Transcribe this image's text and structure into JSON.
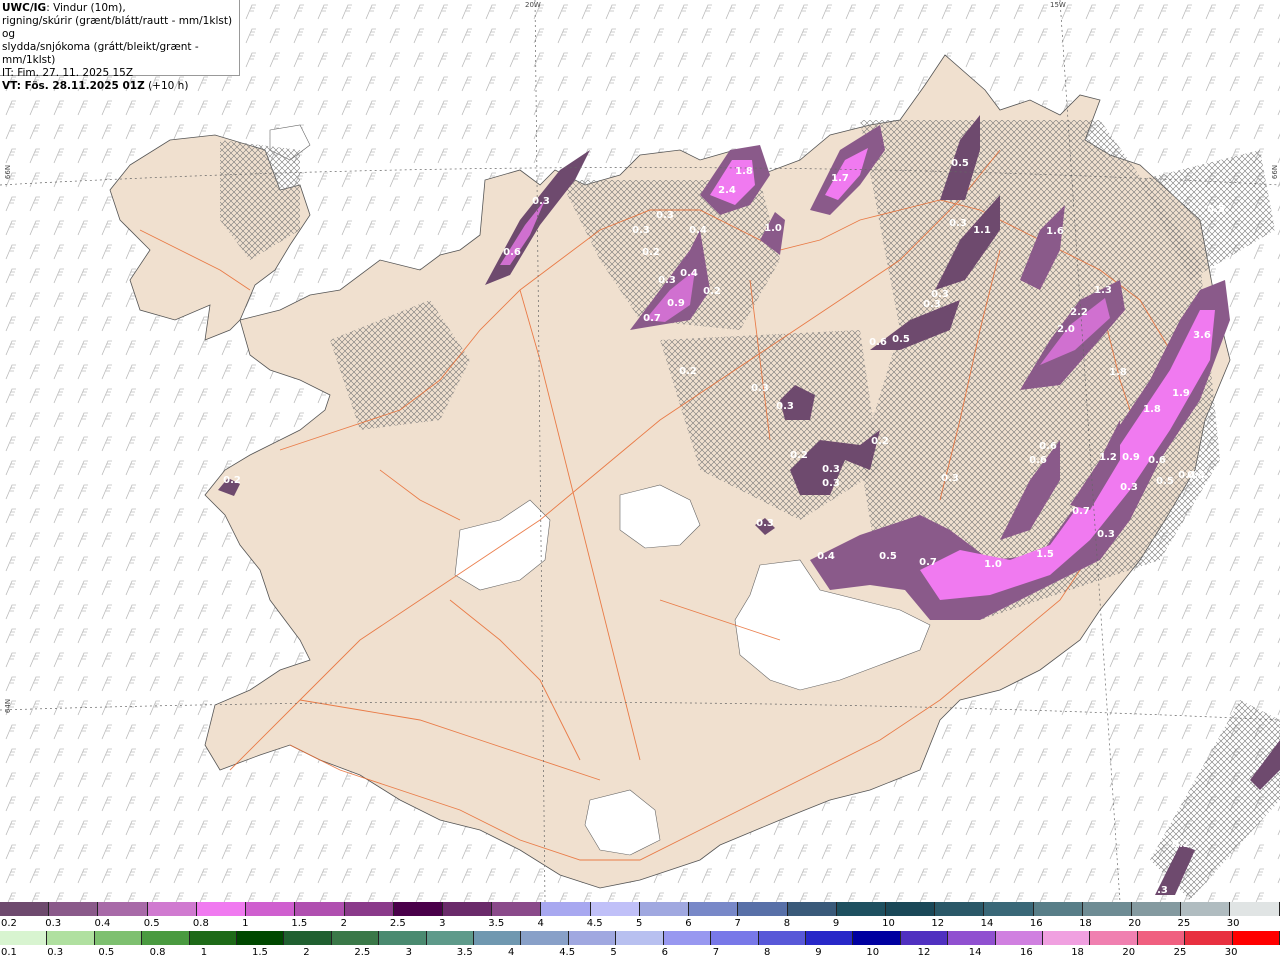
{
  "info": {
    "model": "UWC/IG",
    "line1_rest": ": Vindur (10m),",
    "line2": "rigning/skúrir (grænt/blátt/rautt - mm/1klst) og",
    "line3": "slydda/snjókoma (grátt/bleikt/grænt - mm/1klst)",
    "it": "IT: Fim. 27. 11. 2025 15Z",
    "vt_bold": "VT: Fös. 28.11.2025 01Z",
    "vt_rest": " (+10 h)"
  },
  "grid_labels": {
    "lon_20w": "20W",
    "lon_15w": "15W",
    "lat_66n_left": "66N",
    "lat_66n_right": "66N",
    "lat_64n_left": "64N"
  },
  "precip_labels": [
    "0.3",
    "0.6",
    "0.2",
    "1.8",
    "2.4",
    "1.7",
    "0.3",
    "0.3",
    "0.4",
    "0.2",
    "0.4",
    "0.3",
    "0.9",
    "0.7",
    "0.2",
    "1.0",
    "0.5",
    "0.3",
    "1.1",
    "1.6",
    "0.5",
    "0.3",
    "0.3",
    "1.3",
    "2.2",
    "2.0",
    "3.6",
    "0.6",
    "0.5",
    "0.2",
    "0.3",
    "0.3",
    "1.8",
    "1.8",
    "1.9",
    "0.2",
    "0.3",
    "0.3",
    "0.2",
    "0.3",
    "0.6",
    "0.6",
    "1.2",
    "0.9",
    "0.6",
    "0.4",
    "0.5",
    "0.3",
    "0.7",
    "0.4",
    "0.5",
    "0.7",
    "1.0",
    "1.5",
    "0.3",
    "0.3",
    "0.2",
    "0.4",
    "0.2",
    "0.3"
  ],
  "legend_snow": {
    "labels": [
      "0.2",
      "0.3",
      "0.4",
      "0.5",
      "0.8",
      "1",
      "1.5",
      "2",
      "2.5",
      "3",
      "3.5",
      "4",
      "4.5",
      "5",
      "6",
      "7",
      "8",
      "9",
      "10",
      "12",
      "14",
      "16",
      "18",
      "20",
      "25",
      "30"
    ],
    "colors": [
      "#6e4a6e",
      "#8a5a8a",
      "#a86aa8",
      "#d07ad0",
      "#f07af0",
      "#cf5fcf",
      "#b04fb0",
      "#8a3a8a",
      "#4a004a",
      "#6a2a6a",
      "#8a4a8a",
      "#a8a8f0",
      "#c0c0f8",
      "#a0a8e0",
      "#7888c8",
      "#5870a8",
      "#3a5a7a",
      "#1e5060",
      "#1a4858",
      "#2a5868",
      "#3a6878",
      "#587e88",
      "#6e8c94",
      "#849aa0",
      "#b0bcc0",
      "#e0e4e4"
    ]
  },
  "legend_rain": {
    "labels": [
      "0.1",
      "0.3",
      "0.5",
      "0.8",
      "1",
      "1.5",
      "2",
      "2.5",
      "3",
      "3.5",
      "4",
      "4.5",
      "5",
      "6",
      "7",
      "8",
      "9",
      "10",
      "12",
      "14",
      "16",
      "18",
      "20",
      "25",
      "30"
    ],
    "colors": [
      "#d8f4d0",
      "#b0e0a0",
      "#7ec070",
      "#4a9a40",
      "#1e6a18",
      "#004800",
      "#206030",
      "#3a7848",
      "#4a8a70",
      "#5e9a8a",
      "#7098b0",
      "#88a0c8",
      "#a0a8e0",
      "#b8c0f0",
      "#9898f0",
      "#7878e8",
      "#5858d8",
      "#2828c8",
      "#0000a0",
      "#5030c0",
      "#9050d0",
      "#d080e0",
      "#f0a0e0",
      "#f080b0",
      "#f06080",
      "#e83040",
      "#ff0000"
    ]
  }
}
